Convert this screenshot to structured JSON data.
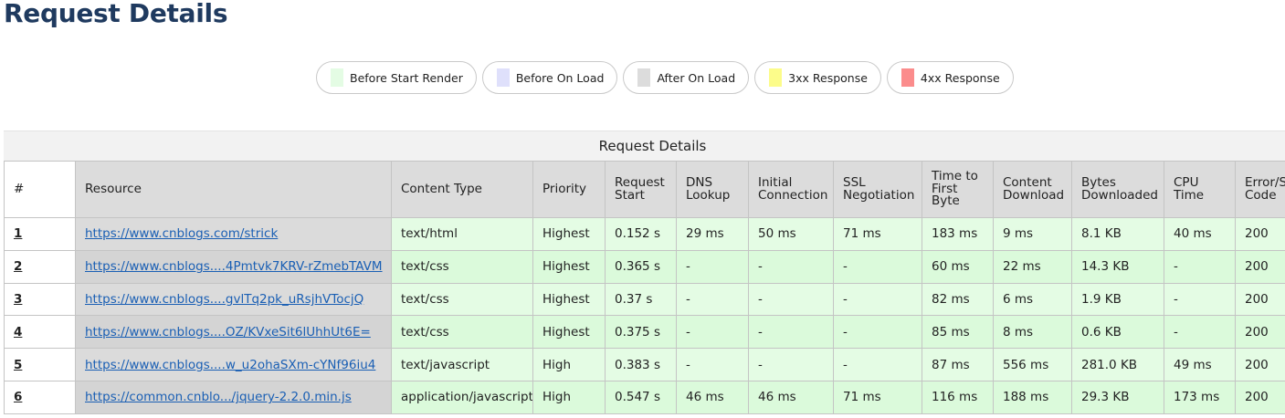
{
  "page": {
    "title": "Request Details"
  },
  "legend": [
    {
      "label": "Before Start Render",
      "color": "#e4fce4"
    },
    {
      "label": "Before On Load",
      "color": "#dfe0fb"
    },
    {
      "label": "After On Load",
      "color": "#dcdcdc"
    },
    {
      "label": "3xx Response",
      "color": "#fcfc8a"
    },
    {
      "label": "4xx Response",
      "color": "#fb8c8c"
    }
  ],
  "table": {
    "caption": "Request Details",
    "headers": {
      "num": "#",
      "resource": "Resource",
      "content_type": "Content Type",
      "priority": "Priority",
      "request_start_1": "Request",
      "request_start_2": "Start",
      "dns_1": "DNS",
      "dns_2": "Lookup",
      "initial_1": "Initial",
      "initial_2": "Connection",
      "ssl_1": "SSL",
      "ssl_2": "Negotiation",
      "ttfb_1": "Time to",
      "ttfb_2": "First",
      "ttfb_3": "Byte",
      "content_dl_1": "Content",
      "content_dl_2": "Download",
      "bytes_1": "Bytes",
      "bytes_2": "Downloaded",
      "cpu_1": "CPU",
      "cpu_2": "Time",
      "error_1": "Error/Status",
      "error_2": "Code"
    },
    "rows": [
      {
        "num": "1",
        "resource": "https://www.cnblogs.com/strick",
        "content_type": "text/html",
        "priority": "Highest",
        "request_start": "0.152 s",
        "dns": "29 ms",
        "initial": "50 ms",
        "ssl": "71 ms",
        "ttfb": "183 ms",
        "content_dl": "9 ms",
        "bytes": "8.1 KB",
        "cpu": "40 ms",
        "status": "200"
      },
      {
        "num": "2",
        "resource": "https://www.cnblogs....4Pmtvk7KRV-rZmebTAVM",
        "content_type": "text/css",
        "priority": "Highest",
        "request_start": "0.365 s",
        "dns": "-",
        "initial": "-",
        "ssl": "-",
        "ttfb": "60 ms",
        "content_dl": "22 ms",
        "bytes": "14.3 KB",
        "cpu": "-",
        "status": "200"
      },
      {
        "num": "3",
        "resource": "https://www.cnblogs....gvlTq2pk_uRsjhVTocjQ",
        "content_type": "text/css",
        "priority": "Highest",
        "request_start": "0.37 s",
        "dns": "-",
        "initial": "-",
        "ssl": "-",
        "ttfb": "82 ms",
        "content_dl": "6 ms",
        "bytes": "1.9 KB",
        "cpu": "-",
        "status": "200"
      },
      {
        "num": "4",
        "resource": "https://www.cnblogs....OZ/KVxeSit6lUhhUt6E=",
        "content_type": "text/css",
        "priority": "Highest",
        "request_start": "0.375 s",
        "dns": "-",
        "initial": "-",
        "ssl": "-",
        "ttfb": "85 ms",
        "content_dl": "8 ms",
        "bytes": "0.6 KB",
        "cpu": "-",
        "status": "200"
      },
      {
        "num": "5",
        "resource": "https://www.cnblogs....w_u2ohaSXm-cYNf96iu4",
        "content_type": "text/javascript",
        "priority": "High",
        "request_start": "0.383 s",
        "dns": "-",
        "initial": "-",
        "ssl": "-",
        "ttfb": "87 ms",
        "content_dl": "556 ms",
        "bytes": "281.0 KB",
        "cpu": "49 ms",
        "status": "200"
      },
      {
        "num": "6",
        "resource": "https://common.cnblo.../jquery-2.2.0.min.js",
        "content_type": "application/javascript",
        "priority": "High",
        "request_start": "0.547 s",
        "dns": "46 ms",
        "initial": "46 ms",
        "ssl": "71 ms",
        "ttfb": "116 ms",
        "content_dl": "188 ms",
        "bytes": "29.3 KB",
        "cpu": "173 ms",
        "status": "200"
      }
    ]
  }
}
